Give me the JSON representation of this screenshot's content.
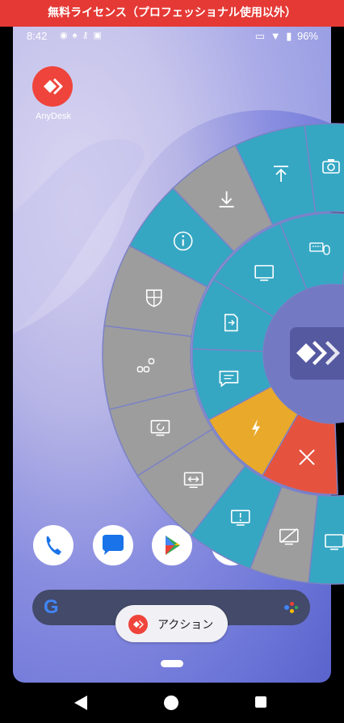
{
  "banner": {
    "text": "無料ライセンス（プロフェッショナル使用以外）"
  },
  "status_bar": {
    "time": "8:42",
    "battery": "96%"
  },
  "home_apps": [
    {
      "label": "AnyDesk"
    }
  ],
  "search_bar": {
    "logo": "G"
  },
  "action_button": {
    "label": "アクション"
  },
  "radial_menu": {
    "colors": {
      "teal": "#35a7c3",
      "gray": "#9d9d9d",
      "yellow": "#e9a92b",
      "red": "#e5533f",
      "divider": "#7b82c6"
    },
    "outer_ring": [
      {
        "name": "screenshot-button",
        "icon": "camera-icon",
        "color": "teal"
      },
      {
        "name": "upload-button",
        "icon": "upload-icon",
        "color": "teal"
      },
      {
        "name": "download-button",
        "icon": "download-icon",
        "color": "gray"
      },
      {
        "name": "info-button",
        "icon": "info-icon",
        "color": "teal"
      },
      {
        "name": "permissions-button",
        "icon": "shield-icon",
        "color": "gray"
      },
      {
        "name": "share-button",
        "icon": "share-icon",
        "color": "gray"
      },
      {
        "name": "restart-button",
        "icon": "restart-icon",
        "color": "gray"
      },
      {
        "name": "resize-button",
        "icon": "resize-icon",
        "color": "gray"
      },
      {
        "name": "display-info-button",
        "icon": "monitor-info-icon",
        "color": "teal"
      },
      {
        "name": "privacy-button",
        "icon": "eye-off-icon",
        "color": "gray"
      },
      {
        "name": "display-button",
        "icon": "monitor-icon",
        "color": "teal"
      }
    ],
    "middle_ring": [
      {
        "name": "settings-button",
        "icon": "wrench-icon",
        "color": "teal"
      },
      {
        "name": "input-button",
        "icon": "keyboard-mouse-icon",
        "color": "teal"
      },
      {
        "name": "monitor-button",
        "icon": "monitor-icon",
        "color": "teal"
      },
      {
        "name": "file-transfer-button",
        "icon": "file-transfer-icon",
        "color": "teal"
      },
      {
        "name": "chat-button",
        "icon": "chat-icon",
        "color": "teal"
      },
      {
        "name": "quick-action-button",
        "icon": "lightning-icon",
        "color": "yellow"
      },
      {
        "name": "disconnect-button",
        "icon": "close-icon",
        "color": "red"
      }
    ]
  }
}
